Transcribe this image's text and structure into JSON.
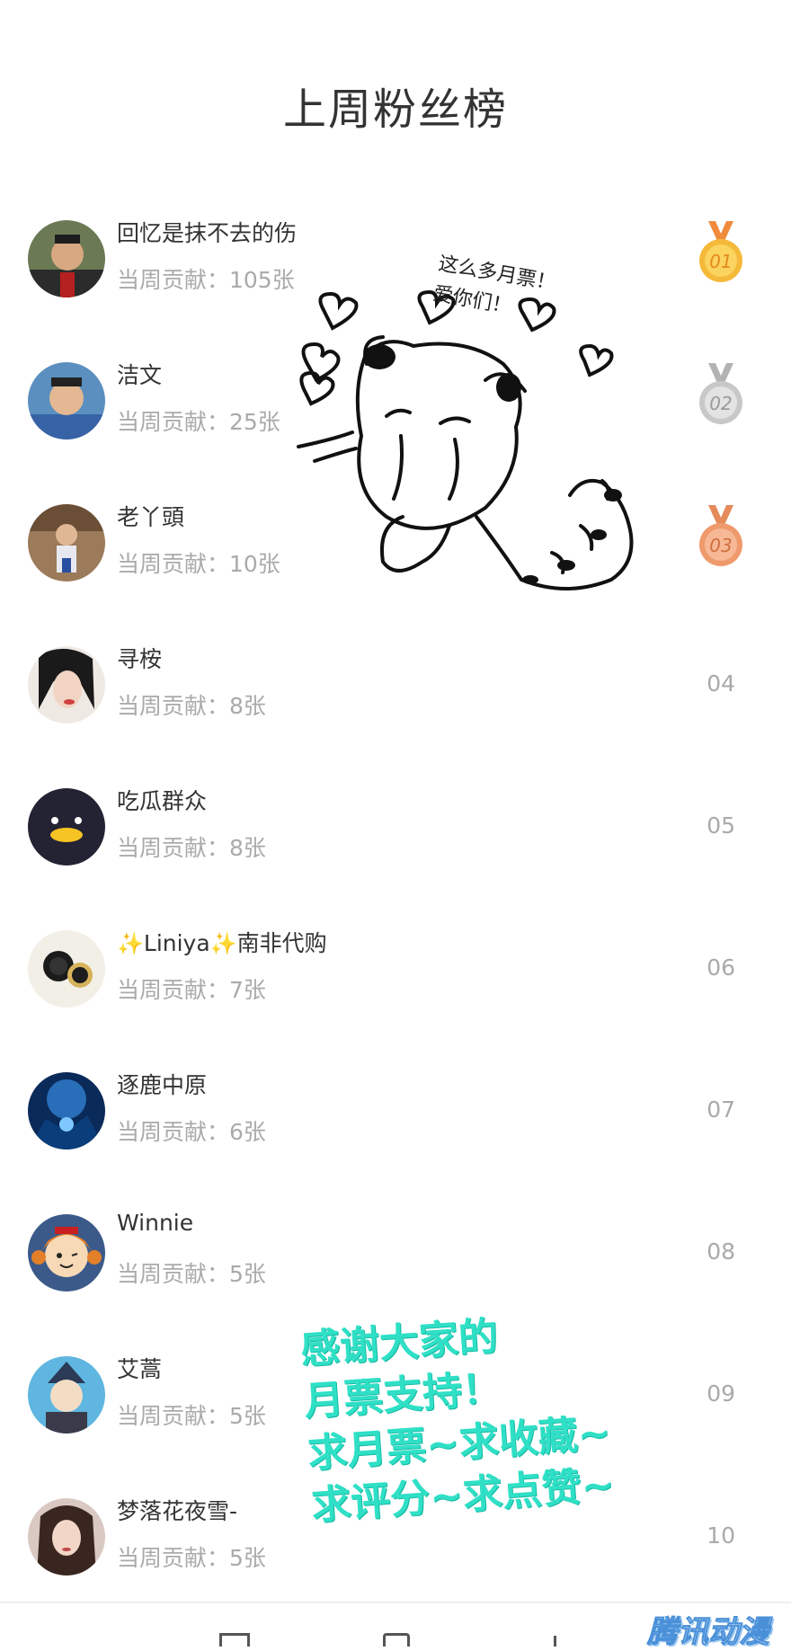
{
  "title": "上周粉丝榜",
  "fans": [
    {
      "name": "回忆是抹不去的伤",
      "contribution": "当周贡献：105张",
      "rank": "01",
      "medal": "gold"
    },
    {
      "name": "洁文",
      "contribution": "当周贡献：25张",
      "rank": "02",
      "medal": "silver"
    },
    {
      "name": "老丫頭",
      "contribution": "当周贡献：10张",
      "rank": "03",
      "medal": "bronze"
    },
    {
      "name": "寻桉",
      "contribution": "当周贡献：8张",
      "rank": "04"
    },
    {
      "name": "吃瓜群众",
      "contribution": "当周贡献：8张",
      "rank": "05"
    },
    {
      "name_prefix": "✨",
      "name_main": "Liniya",
      "name_mid": "✨",
      "name_suffix": "南非代购",
      "contribution": "当周贡献：7张",
      "rank": "06"
    },
    {
      "name": "逐鹿中原",
      "contribution": "当周贡献：6张",
      "rank": "07"
    },
    {
      "name": "Winnie",
      "contribution": "当周贡献：5张",
      "rank": "08"
    },
    {
      "name": "艾蒿",
      "contribution": "当周贡献：5张",
      "rank": "09"
    },
    {
      "name": "梦落花夜雪-",
      "contribution": "当周贡献：5张",
      "rank": "10"
    }
  ],
  "doodle": {
    "line1": "这么多月票！",
    "line2": "爱你们！"
  },
  "thanks": {
    "line1": "感谢大家的",
    "line2": "月票支持！",
    "line3": "求月票~求收藏~",
    "line4": "求评分~求点赞~"
  },
  "watermark": "腾讯动漫",
  "colors": {
    "gold": "#f5b93a",
    "silver": "#c8c8c8",
    "bronze": "#ef9a6c",
    "accent_text": "#2fe0c6"
  }
}
